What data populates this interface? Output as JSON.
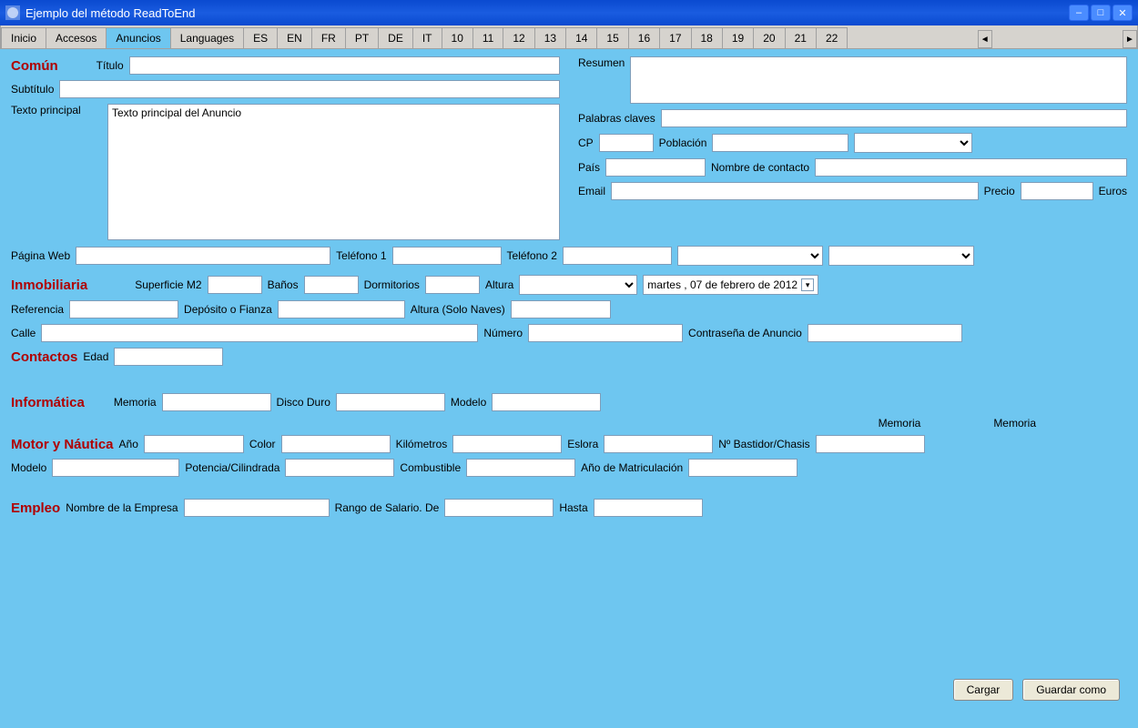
{
  "window": {
    "title": "Ejemplo del método ReadToEnd"
  },
  "tabs": [
    "Inicio",
    "Accesos",
    "Anuncios",
    "Languages",
    "ES",
    "EN",
    "FR",
    "PT",
    "DE",
    "IT",
    "10",
    "11",
    "12",
    "13",
    "14",
    "15",
    "16",
    "17",
    "18",
    "19",
    "20",
    "21",
    "22"
  ],
  "active_tab_index": 2,
  "sections": {
    "comun": {
      "title": "Común",
      "titulo_label": "Título",
      "subtitulo_label": "Subtítulo",
      "texto_principal_label": "Texto principal",
      "texto_principal_value": "Texto principal del Anuncio",
      "resumen_label": "Resumen",
      "palabras_claves_label": "Palabras claves",
      "cp_label": "CP",
      "poblacion_label": "Población",
      "pais_label": "País",
      "nombre_contacto_label": "Nombre de contacto",
      "email_label": "Email",
      "precio_label": "Precio",
      "euros_label": "Euros",
      "pagina_web_label": "Página Web",
      "telefono1_label": "Teléfono 1",
      "telefono2_label": "Teléfono 2"
    },
    "inmobiliaria": {
      "title": "Inmobiliaria",
      "superficie_label": "Superficie M2",
      "banos_label": "Baños",
      "dormitorios_label": "Dormitorios",
      "altura_label": "Altura",
      "date_value": "martes , 07 de  febrero   de 2012",
      "referencia_label": "Referencia",
      "deposito_label": "Depósito o Fianza",
      "altura_naves_label": "Altura (Solo Naves)",
      "calle_label": "Calle",
      "numero_label": "Número",
      "contrasena_label": "Contraseña de Anuncio"
    },
    "contactos": {
      "title": "Contactos",
      "edad_label": "Edad"
    },
    "informatica": {
      "title": "Informática",
      "memoria_label": "Memoria",
      "disco_duro_label": "Disco Duro",
      "modelo_label": "Modelo",
      "memoria2_label": "Memoria",
      "memoria3_label": "Memoria"
    },
    "motor": {
      "title": "Motor y Náutica",
      "ano_label": "Año",
      "color_label": "Color",
      "kilometros_label": "Kilómetros",
      "eslora_label": "Eslora",
      "bastidor_label": "Nº Bastidor/Chasis",
      "modelo_label": "Modelo",
      "potencia_label": "Potencia/Cilindrada",
      "combustible_label": "Combustible",
      "ano_matriculacion_label": "Año de Matriculación"
    },
    "empleo": {
      "title": "Empleo",
      "empresa_label": "Nombre de la Empresa",
      "rango_salario_label": "Rango de Salario. De",
      "hasta_label": "Hasta"
    }
  },
  "buttons": {
    "cargar": "Cargar",
    "guardar_como": "Guardar como"
  }
}
